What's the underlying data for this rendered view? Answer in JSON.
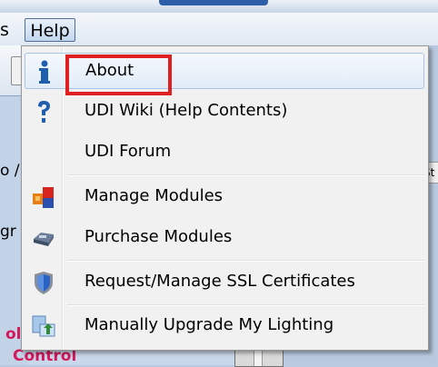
{
  "menubar": {
    "partial_item": "s",
    "help_label": "Help"
  },
  "background": {
    "frag_a": "o /",
    "frag_b": "gr",
    "frag_c": "ol",
    "frag_d": "Control",
    "frag_right": "St"
  },
  "help_menu": {
    "items": [
      {
        "label": "About",
        "icon": "info-icon"
      },
      {
        "label": "UDI Wiki (Help Contents)",
        "icon": "question-icon"
      },
      {
        "label": "UDI Forum",
        "icon": ""
      },
      {
        "label": "Manage Modules",
        "icon": "modules-icon"
      },
      {
        "label": "Purchase Modules",
        "icon": "purchase-icon"
      },
      {
        "label": "Request/Manage SSL Certificates",
        "icon": "shield-icon"
      },
      {
        "label": "Manually Upgrade My Lighting",
        "icon": "upgrade-icon"
      }
    ]
  },
  "colors": {
    "highlight": "#e02020",
    "menu_bg": "#f1f1f1",
    "hover_border": "#a8c4e8"
  }
}
